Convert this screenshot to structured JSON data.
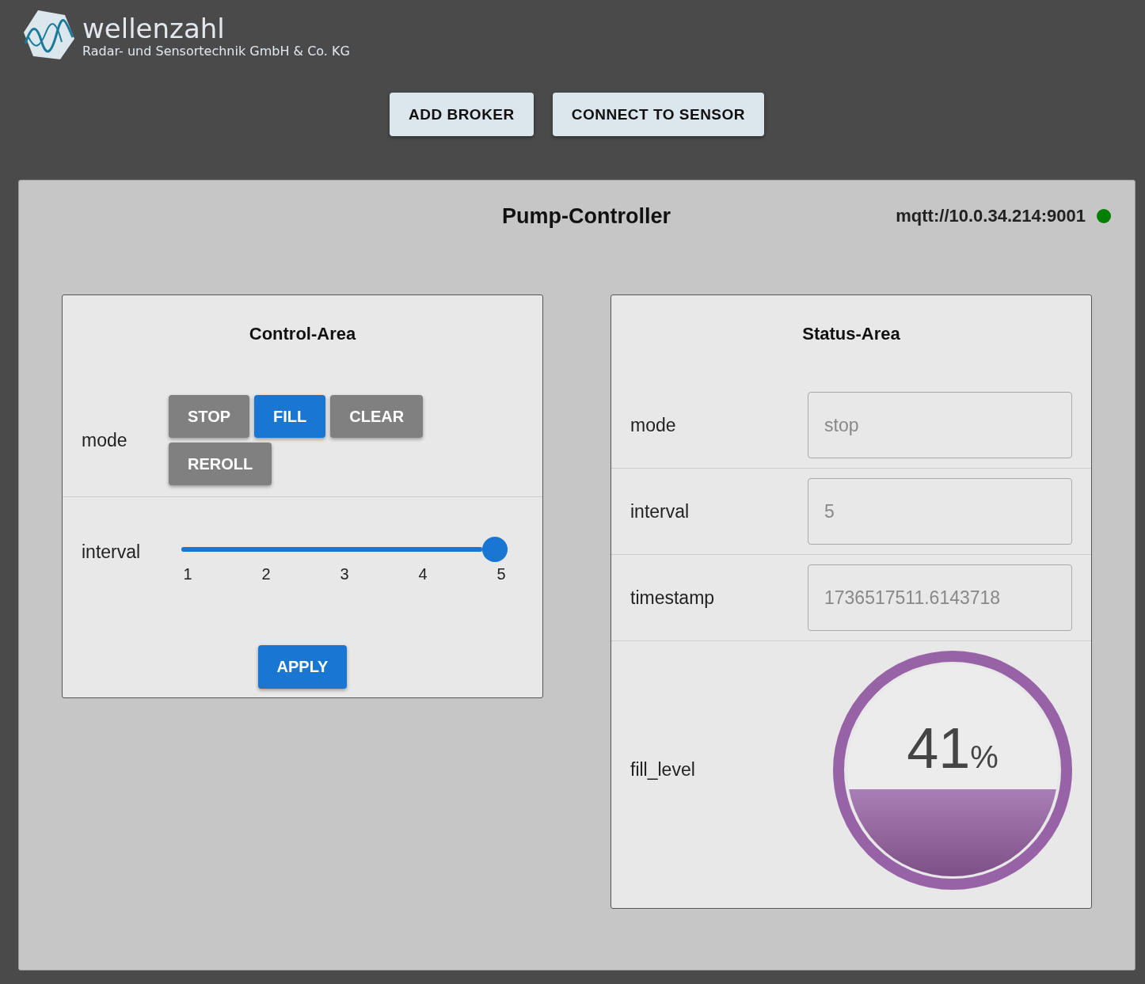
{
  "header": {
    "brand": "wellenzahl",
    "tagline": "Radar- und Sensortechnik GmbH & Co. KG"
  },
  "top_buttons": [
    "ADD BROKER",
    "CONNECT TO SENSOR"
  ],
  "panel": {
    "title": "Pump-Controller",
    "broker": "mqtt://10.0.34.214:9001",
    "broker_status": {
      "color": "#008000"
    }
  },
  "control_area": {
    "title": "Control-Area",
    "mode": {
      "label": "mode",
      "options": [
        {
          "label": "STOP",
          "selected": false
        },
        {
          "label": "FILL",
          "selected": true
        },
        {
          "label": "CLEAR",
          "selected": false
        },
        {
          "label": "REROLL",
          "selected": false
        }
      ]
    },
    "interval": {
      "label": "interval",
      "level": 1.0,
      "ticks": [
        "1",
        "2",
        "3",
        "4",
        "5"
      ]
    },
    "apply": "APPLY"
  },
  "status_area": {
    "title": "Status-Area",
    "fields": [
      {
        "label": "mode",
        "value": "stop",
        "disabled": true
      },
      {
        "label": "interval",
        "value": "5",
        "disabled": true
      },
      {
        "label": "timestamp",
        "value": "1736517511.6143718",
        "disabled": true
      }
    ],
    "fill_level": {
      "label": "fill_level",
      "level": 0.41,
      "value": "41",
      "unit": "%"
    }
  }
}
